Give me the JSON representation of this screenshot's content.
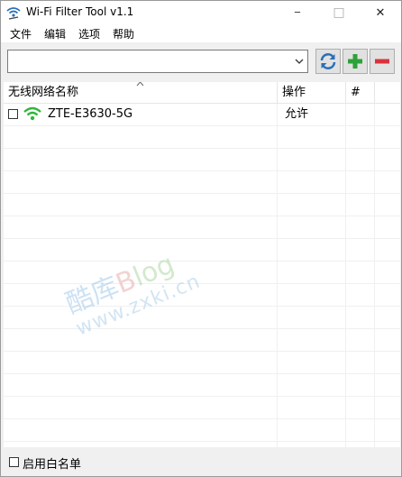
{
  "window": {
    "title": "Wi-Fi Filter Tool v1.1",
    "minimize_glyph": "─",
    "maximize_glyph": "□",
    "close_glyph": "✕"
  },
  "menu": [
    "文件",
    "编辑",
    "选项",
    "帮助"
  ],
  "toolbar": {
    "network_combo_value": "",
    "buttons": [
      "refresh-icon",
      "plus-icon",
      "minus-icon"
    ]
  },
  "table": {
    "columns": [
      "无线网络名称",
      "操作",
      "#"
    ],
    "rows": [
      {
        "checked": false,
        "ssid": "ZTE-E3630-5G",
        "action": "允许",
        "index": ""
      }
    ]
  },
  "watermark": {
    "line1_a": "酷库",
    "line1_b": "B",
    "line1_c": "log",
    "line2": "www.zxki.cn"
  },
  "status": {
    "whitelist_label": "启用白名单",
    "whitelist_checked": false
  },
  "colors": {
    "wifi_green": "#2fb53b",
    "add_green": "#2ea13a",
    "remove_red": "#d9323c",
    "refresh_blue": "#2a6fb8"
  }
}
